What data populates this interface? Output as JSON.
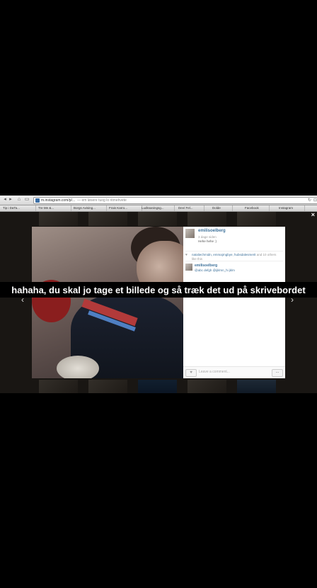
{
  "browser": {
    "url_text": "m.instagram.com/p/...",
    "tab_title": "— em løsere tuog lo ritmehvete",
    "bookmarks": [
      "Tip i DaTa...",
      "Tre Me &...",
      "Borgs Avising...",
      "Frais Karro...",
      "Ludksaningsg...",
      "Dev/ Fel...",
      "Dolde",
      "Facebook",
      "Instagram"
    ]
  },
  "post": {
    "username": "emilisoelberg",
    "time_ago": "3 dage siden",
    "caption": "Hehe hehe :)",
    "likes_names": "nataliechmidn, emmajrngbye, hubsdalesmerit",
    "likes_rest": " and 10 others",
    "likes_line2": "like this",
    "comment_username": "emilisoelberg",
    "comment_text": "@abc defgh @ijklmn_hi jklm"
  },
  "footer": {
    "comment_placeholder": "Leave a comment..."
  },
  "subtitle": "hahaha, du skal jo tage et billede og så træk det ud på skrivebordet",
  "icons": {
    "close": "×",
    "prev": "‹",
    "next": "›",
    "heart": "♥",
    "more": "..."
  }
}
